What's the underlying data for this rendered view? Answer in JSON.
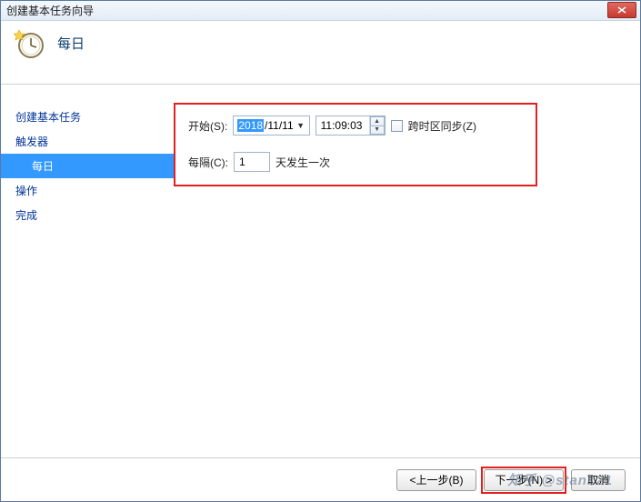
{
  "window": {
    "title": "创建基本任务向导"
  },
  "header": {
    "heading": "每日",
    "icon": "clock-new-icon"
  },
  "sidebar": {
    "items": [
      {
        "label": "创建基本任务",
        "sub": false,
        "selected": false
      },
      {
        "label": "触发器",
        "sub": false,
        "selected": false
      },
      {
        "label": "每日",
        "sub": true,
        "selected": true
      },
      {
        "label": "操作",
        "sub": false,
        "selected": false
      },
      {
        "label": "完成",
        "sub": false,
        "selected": false
      }
    ]
  },
  "form": {
    "start_label": "开始(S):",
    "date_year": "2018",
    "date_rest": "/11/11",
    "time_value": "11:09:03",
    "tz_sync_label": "跨时区同步(Z)",
    "tz_sync_checked": false,
    "interval_label": "每隔(C):",
    "interval_value": "1",
    "interval_suffix": "天发生一次"
  },
  "footer": {
    "back": "<上一步(B)",
    "next": "下一步(N) >",
    "cancel": "取消"
  },
  "watermark": "知乎 @stan121"
}
